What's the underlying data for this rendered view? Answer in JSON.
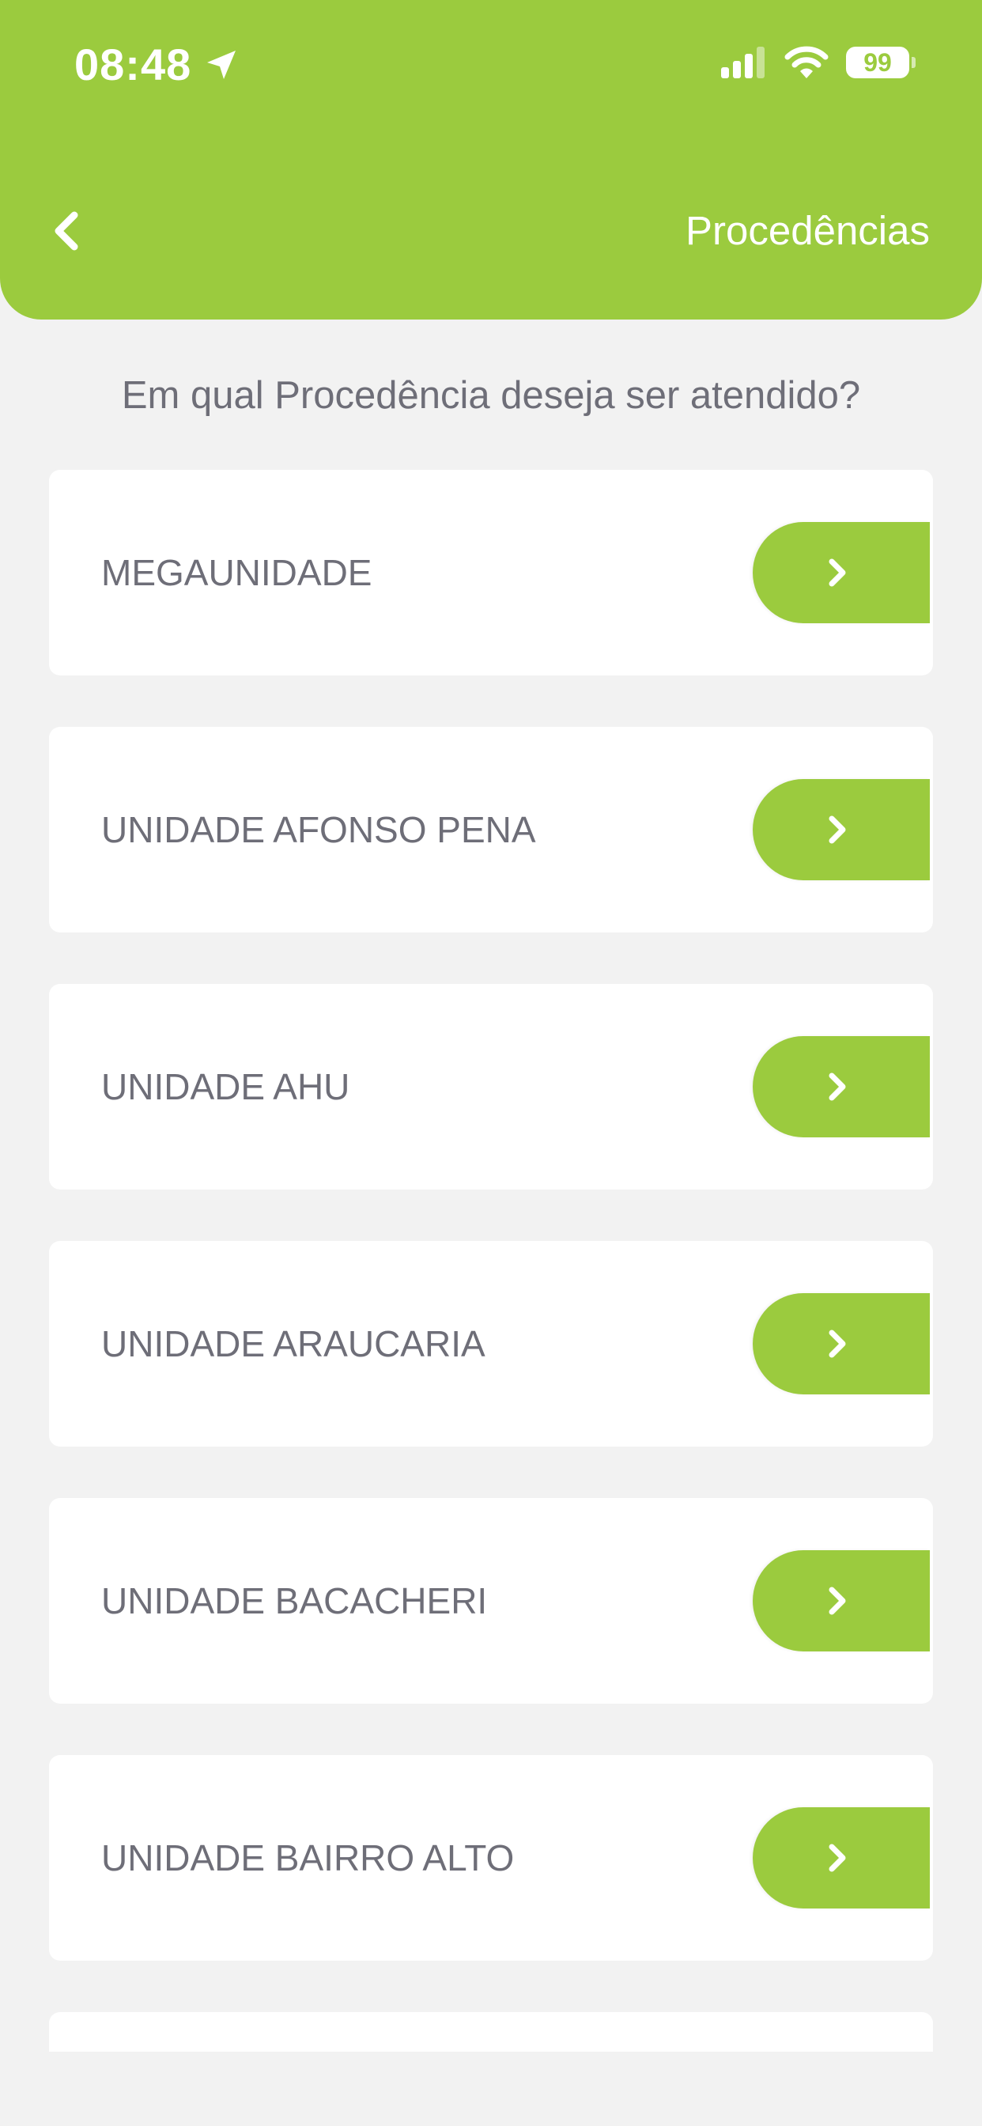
{
  "status_bar": {
    "time": "08:48",
    "battery": "99",
    "icons": [
      "location-arrow-icon",
      "signal-icon",
      "wifi-icon",
      "battery-icon"
    ]
  },
  "header": {
    "title": "Procedências",
    "back_icon": "chevron-left-icon"
  },
  "question": "Em qual Procedência deseja ser atendido?",
  "items": [
    {
      "label": "MEGAUNIDADE"
    },
    {
      "label": "UNIDADE AFONSO PENA"
    },
    {
      "label": "UNIDADE AHU"
    },
    {
      "label": "UNIDADE ARAUCARIA"
    },
    {
      "label": "UNIDADE BACACHERI"
    },
    {
      "label": "UNIDADE BAIRRO ALTO"
    }
  ],
  "colors": {
    "accent": "#9bcb3e",
    "background": "#f2f2f2",
    "card": "#ffffff",
    "text": "#6e6e78"
  }
}
